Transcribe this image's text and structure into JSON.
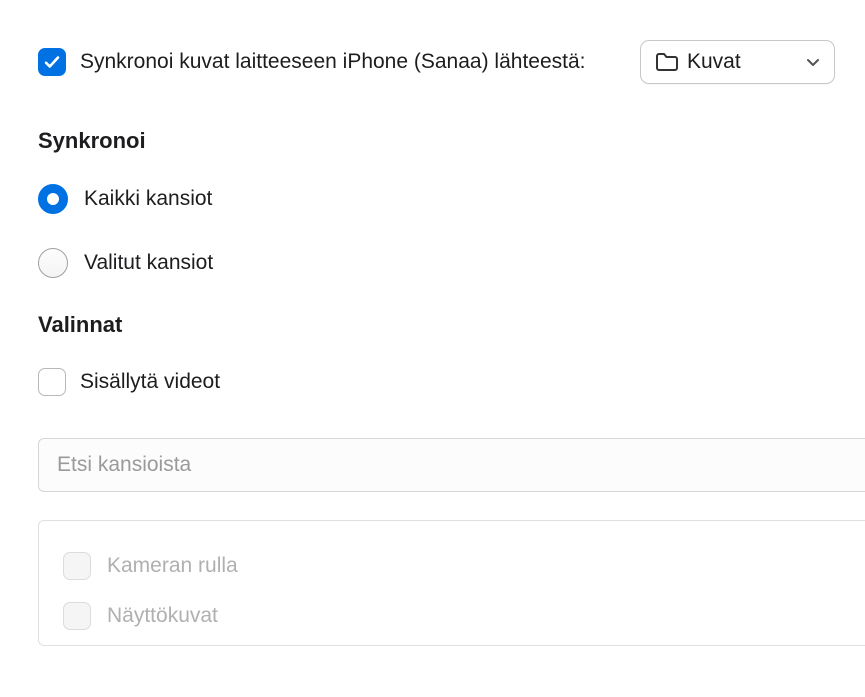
{
  "sync": {
    "checked": true,
    "label": "Synkronoi kuvat laitteeseen iPhone (Sanaa) lähteestä:",
    "sourceValue": "Kuvat"
  },
  "syncSection": {
    "title": "Synkronoi",
    "options": [
      {
        "label": "Kaikki kansiot",
        "selected": true
      },
      {
        "label": "Valitut kansiot",
        "selected": false
      }
    ]
  },
  "optionsSection": {
    "title": "Valinnat",
    "includeVideos": {
      "label": "Sisällytä videot",
      "checked": false
    }
  },
  "search": {
    "placeholder": "Etsi kansioista"
  },
  "folders": [
    {
      "label": "Kameran rulla",
      "checked": false
    },
    {
      "label": "Näyttökuvat",
      "checked": false
    }
  ]
}
